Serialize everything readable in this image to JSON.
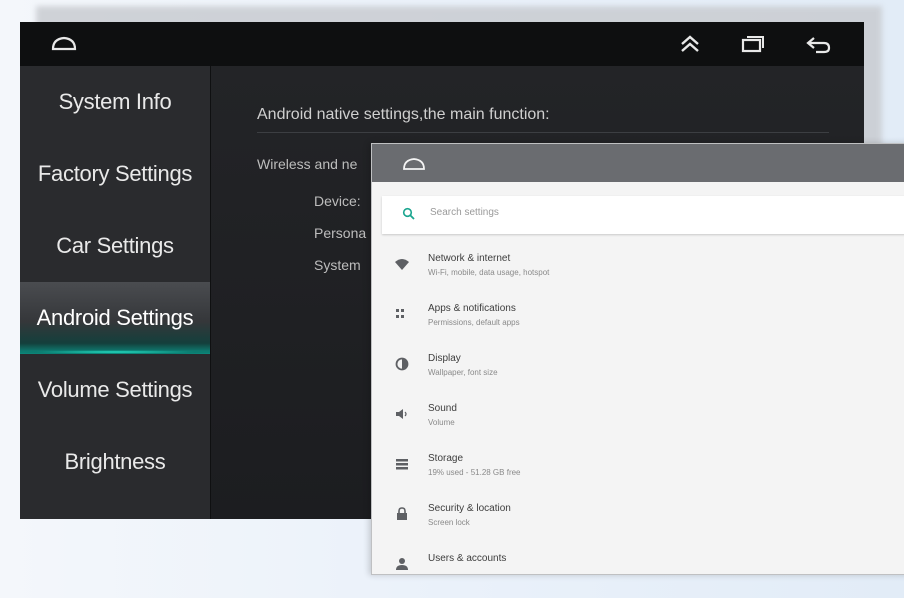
{
  "head_unit": {
    "topbar": {
      "home_icon": "home-icon",
      "icons": [
        "double-chevron-up-icon",
        "recent-apps-icon",
        "back-arrow-icon"
      ]
    },
    "sidebar": {
      "items": [
        {
          "label": "System Info"
        },
        {
          "label": "Factory Settings"
        },
        {
          "label": "Car Settings"
        },
        {
          "label": "Android Settings",
          "active": true
        },
        {
          "label": "Volume Settings"
        },
        {
          "label": "Brightness"
        }
      ]
    },
    "main": {
      "heading": "Android native settings,the main function:",
      "line1": "Wireless and ne",
      "line2": "Device:",
      "line3": "Persona",
      "line4": "System"
    },
    "colors": {
      "accent": "#0e8d80",
      "sidebar_bg": "#2a2b2e",
      "main_bg": "#1c1d20"
    }
  },
  "android_settings": {
    "search_placeholder": "Search settings",
    "items": [
      {
        "title": "Network & internet",
        "subtitle": "Wi-Fi, mobile, data usage, hotspot",
        "icon": "wifi-icon"
      },
      {
        "title": "Apps & notifications",
        "subtitle": "Permissions, default apps",
        "icon": "apps-icon"
      },
      {
        "title": "Display",
        "subtitle": "Wallpaper, font size",
        "icon": "brightness-icon"
      },
      {
        "title": "Sound",
        "subtitle": "Volume",
        "icon": "volume-icon"
      },
      {
        "title": "Storage",
        "subtitle": "19% used - 51.28 GB free",
        "icon": "storage-icon"
      },
      {
        "title": "Security & location",
        "subtitle": "Screen lock",
        "icon": "lock-icon"
      },
      {
        "title": "Users & accounts",
        "subtitle": "",
        "icon": "user-icon"
      }
    ]
  }
}
